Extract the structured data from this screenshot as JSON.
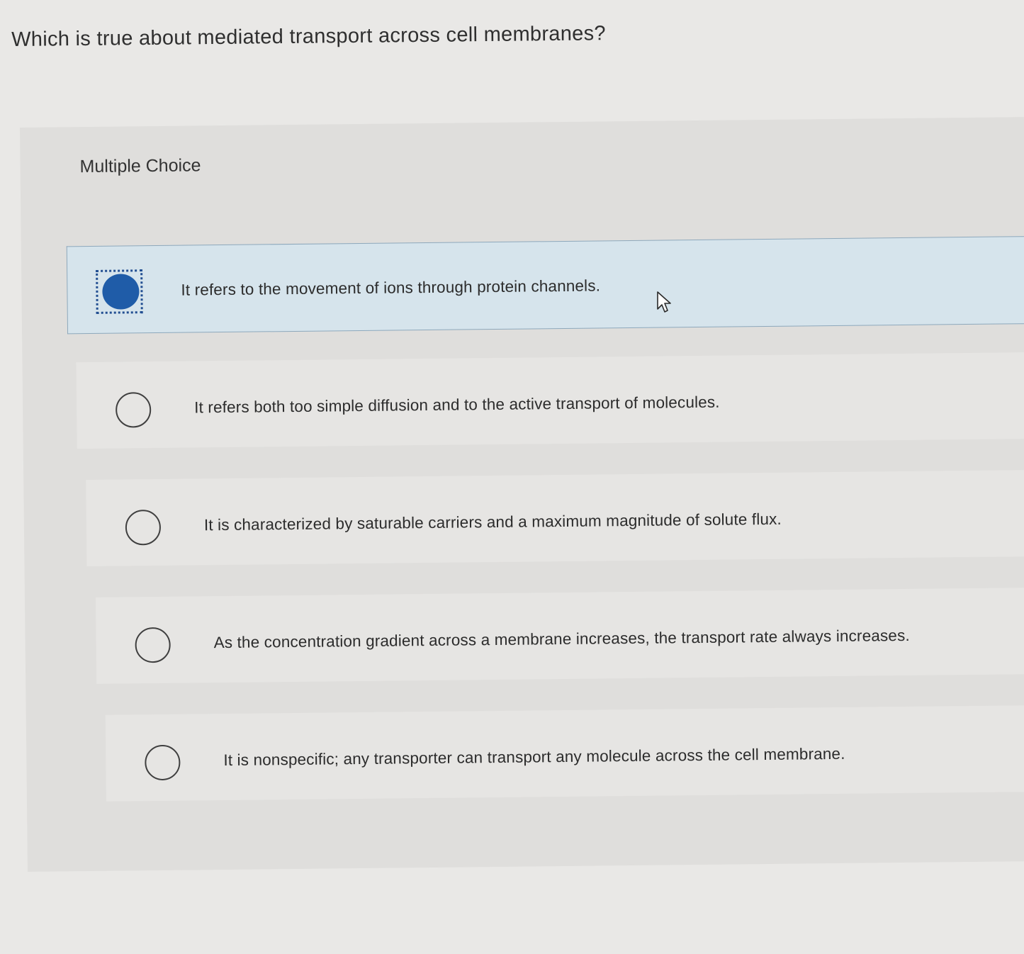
{
  "question": {
    "text": "Which is true about mediated transport across cell membranes?"
  },
  "panel": {
    "header": "Multiple Choice"
  },
  "options": [
    {
      "text": "It refers to the movement of ions through protein channels.",
      "selected": true
    },
    {
      "text": "It refers both too simple diffusion and to the active transport of molecules.",
      "selected": false
    },
    {
      "text": "It is characterized by saturable carriers and a maximum magnitude of solute flux.",
      "selected": false
    },
    {
      "text": "As the concentration gradient across a membrane increases, the transport rate always increases.",
      "selected": false
    },
    {
      "text": "It is nonspecific; any transporter can transport any molecule across the cell membrane.",
      "selected": false
    }
  ],
  "colors": {
    "selected_fill": "#1f5ca8",
    "selected_background": "#d6e4ec",
    "focus_outline": "#234f92"
  },
  "icons": {
    "cursor": "mouse-pointer-icon"
  }
}
